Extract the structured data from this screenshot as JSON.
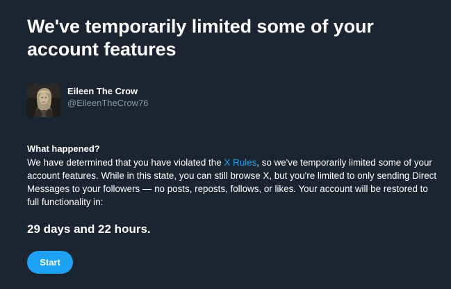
{
  "heading": {
    "title": "We've temporarily limited some of your account features"
  },
  "account": {
    "display_name": "Eileen The Crow",
    "handle": "@EileenTheCrow76",
    "avatar_icon": "profile-photo"
  },
  "notice": {
    "section_heading": "What happened?",
    "body_prefix": "We have determined that you have violated the ",
    "rules_link": "X Rules",
    "body_suffix": ", so we've temporarily limited some of your account features. While in this state, you can still browse X, but you're limited to only sending Direct Messages to your followers — no posts, reposts, follows, or likes. Your account will be restored to full functionality in:",
    "countdown": "29 days and 22 hours."
  },
  "actions": {
    "start_label": "Start"
  },
  "colors": {
    "background": "#1b2431",
    "accent": "#1da1f2",
    "secondary_text": "#8899a6"
  }
}
